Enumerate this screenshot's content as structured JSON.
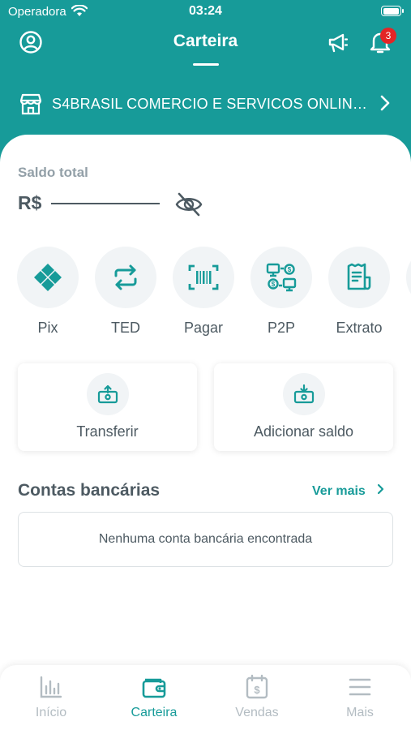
{
  "status_bar": {
    "carrier": "Operadora",
    "time": "03:24"
  },
  "header": {
    "title": "Carteira",
    "notification_count": "3",
    "merchant_name": "S4BRASIL COMERCIO E SERVICOS ONLINE E..."
  },
  "balance": {
    "label": "Saldo total",
    "currency": "R$"
  },
  "quick_actions": [
    {
      "label": "Pix"
    },
    {
      "label": "TED"
    },
    {
      "label": "Pagar"
    },
    {
      "label": "P2P"
    },
    {
      "label": "Extrato"
    }
  ],
  "transfer_buttons": {
    "transfer_label": "Transferir",
    "add_balance_label": "Adicionar saldo"
  },
  "bank_accounts": {
    "title": "Contas bancárias",
    "see_more": "Ver mais",
    "empty_message": "Nenhuma conta bancária encontrada"
  },
  "tab_bar": {
    "active": "Carteira",
    "items": [
      {
        "label": "Início"
      },
      {
        "label": "Carteira"
      },
      {
        "label": "Vendas"
      },
      {
        "label": "Mais"
      }
    ]
  },
  "colors": {
    "brand": "#179b99",
    "text": "#4d5a62",
    "muted": "#b3bcc2",
    "badge": "#e32526"
  }
}
